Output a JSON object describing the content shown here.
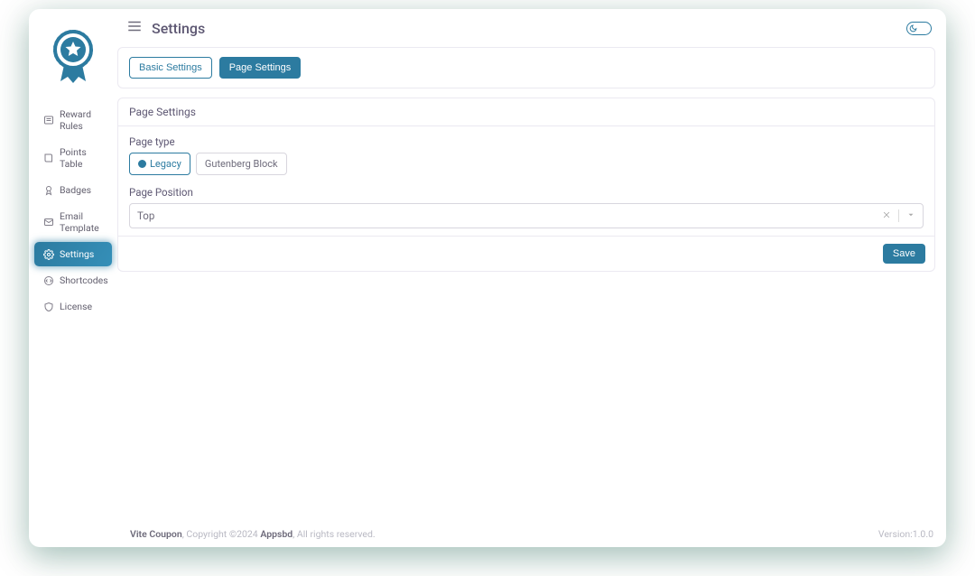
{
  "header": {
    "title": "Settings"
  },
  "sidebar": {
    "items": [
      {
        "label": "Reward Rules",
        "icon": "list-icon"
      },
      {
        "label": "Points Table",
        "icon": "book-icon"
      },
      {
        "label": "Badges",
        "icon": "award-icon"
      },
      {
        "label": "Email Template",
        "icon": "mail-icon"
      },
      {
        "label": "Settings",
        "icon": "gear-icon"
      },
      {
        "label": "Shortcodes",
        "icon": "code-icon"
      },
      {
        "label": "License",
        "icon": "shield-icon"
      }
    ]
  },
  "tabs": {
    "basic": "Basic Settings",
    "page": "Page Settings"
  },
  "panel": {
    "title": "Page Settings",
    "page_type_label": "Page type",
    "page_type_options": {
      "legacy": "Legacy",
      "gutenberg": "Gutenberg Block"
    },
    "page_position_label": "Page Position",
    "page_position_value": "Top",
    "save_label": "Save"
  },
  "footer": {
    "product": "Vite Coupon",
    "copyright_prefix": ", Copyright ©2024 ",
    "company": "Appsbd",
    "rights": ", All rights reserved.",
    "version": "Version:1.0.0"
  }
}
